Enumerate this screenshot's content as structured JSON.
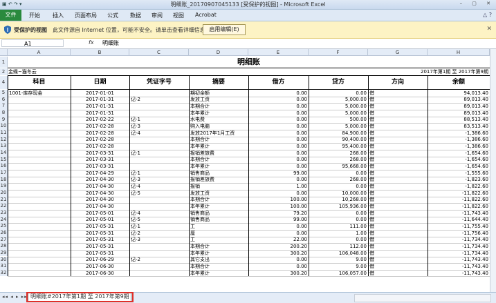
{
  "window": {
    "title": "明细账_20170907045133  [受保护的视图] - Microsoft Excel"
  },
  "ribbon": {
    "file": "文件",
    "tabs": [
      "开始",
      "插入",
      "页面布局",
      "公式",
      "数据",
      "审阅",
      "视图",
      "Acrobat"
    ]
  },
  "protected_bar": {
    "title": "受保护的视图",
    "message": "此文件源自 Internet 位置，可能不安全。请单击查看详细信息。",
    "enable_button": "启用编辑(E)"
  },
  "formula_bar": {
    "name_box": "A1",
    "fx": "fx",
    "content": "明细账"
  },
  "columns": [
    "A",
    "B",
    "C",
    "D",
    "E",
    "F",
    "G",
    "H"
  ],
  "sheet": {
    "title": "明细账",
    "company": "金蝶~猫冬云",
    "period": "2017年第1期 至 2017年第9期",
    "headers": [
      "科目",
      "日期",
      "凭证字号",
      "摘要",
      "借方",
      "贷方",
      "方向",
      "余额"
    ],
    "rows": [
      [
        "1001-库存现金",
        "2017-01-01",
        "",
        "期初余额",
        "0.00",
        "0.00",
        "借",
        "94,013.40"
      ],
      [
        "",
        "2017-01-31",
        "记-2",
        "发放工资",
        "0.00",
        "5,000.00",
        "借",
        "89,013.40"
      ],
      [
        "",
        "2017-01-31",
        "",
        "本期合计",
        "0.00",
        "5,000.00",
        "借",
        "89,013.40"
      ],
      [
        "",
        "2017-01-31",
        "",
        "本年累计",
        "0.00",
        "5,000.00",
        "借",
        "89,013.40"
      ],
      [
        "",
        "2017-02-22",
        "记-1",
        "水电费",
        "0.00",
        "500.00",
        "借",
        "88,513.40"
      ],
      [
        "",
        "2017-02-28",
        "记-3",
        "购入电脑",
        "0.00",
        "5,000.00",
        "借",
        "83,513.40"
      ],
      [
        "",
        "2017-02-28",
        "记-4",
        "发放2017年1月工资",
        "0.00",
        "84,900.00",
        "借",
        "-1,386.60"
      ],
      [
        "",
        "2017-02-28",
        "",
        "本期合计",
        "0.00",
        "90,400.00",
        "借",
        "-1,386.60"
      ],
      [
        "",
        "2017-02-28",
        "",
        "本年累计",
        "0.00",
        "95,400.00",
        "借",
        "-1,386.60"
      ],
      [
        "",
        "2017-03-31",
        "记-1",
        "报销差旅费",
        "0.00",
        "268.00",
        "借",
        "-1,654.60"
      ],
      [
        "",
        "2017-03-31",
        "",
        "本期合计",
        "0.00",
        "268.00",
        "借",
        "-1,654.60"
      ],
      [
        "",
        "2017-03-31",
        "",
        "本年累计",
        "0.00",
        "95,668.00",
        "借",
        "-1,654.60"
      ],
      [
        "",
        "2017-04-29",
        "记-1",
        "销售商品",
        "99.00",
        "0.00",
        "借",
        "-1,555.60"
      ],
      [
        "",
        "2017-04-30",
        "记-3",
        "报销差旅费",
        "0.00",
        "268.00",
        "借",
        "-1,823.60"
      ],
      [
        "",
        "2017-04-30",
        "记-4",
        "报销",
        "1.00",
        "0.00",
        "借",
        "-1,822.60"
      ],
      [
        "",
        "2017-04-30",
        "记-5",
        "发放工资",
        "0.00",
        "10,000.00",
        "借",
        "-11,822.60"
      ],
      [
        "",
        "2017-04-30",
        "",
        "本期合计",
        "100.00",
        "10,268.00",
        "借",
        "-11,822.60"
      ],
      [
        "",
        "2017-04-30",
        "",
        "本年累计",
        "100.00",
        "105,936.00",
        "借",
        "-11,822.60"
      ],
      [
        "",
        "2017-05-01",
        "记-4",
        "销售商品",
        "79.20",
        "0.00",
        "借",
        "-11,743.40"
      ],
      [
        "",
        "2017-05-01",
        "记-5",
        "销售商品",
        "99.00",
        "0.00",
        "借",
        "-11,644.40"
      ],
      [
        "",
        "2017-05-31",
        "记-1",
        "工",
        "0.00",
        "111.00",
        "借",
        "-11,755.40"
      ],
      [
        "",
        "2017-05-31",
        "记-2",
        "厘",
        "0.00",
        "1.00",
        "借",
        "-11,756.40"
      ],
      [
        "",
        "2017-05-31",
        "记-3",
        "工",
        "22.00",
        "0.00",
        "借",
        "-11,734.40"
      ],
      [
        "",
        "2017-05-31",
        "",
        "本期合计",
        "200.20",
        "112.00",
        "借",
        "-11,734.40"
      ],
      [
        "",
        "2017-05-31",
        "",
        "本年累计",
        "300.20",
        "106,048.00",
        "借",
        "-11,734.40"
      ],
      [
        "",
        "2017-06-29",
        "记-2",
        "其它支出",
        "0.00",
        "9.00",
        "借",
        "-11,743.40"
      ],
      [
        "",
        "2017-06-30",
        "",
        "本期合计",
        "0.00",
        "9.00",
        "借",
        "-11,743.40"
      ],
      [
        "",
        "2017-06-30",
        "",
        "本年累计",
        "300.20",
        "106,057.00",
        "借",
        "-11,743.40"
      ]
    ]
  },
  "row_numbers": [
    "1",
    "2",
    "4",
    "5",
    "6",
    "7",
    "8",
    "9",
    "10",
    "11",
    "12",
    "13",
    "14",
    "15",
    "16",
    "17",
    "18",
    "19",
    "20",
    "21",
    "22",
    "23",
    "24",
    "25",
    "26",
    "27",
    "28",
    "29",
    "30",
    "31",
    "32"
  ],
  "sheet_tab": "明细账#2017年第1期 至 2017年第9期"
}
